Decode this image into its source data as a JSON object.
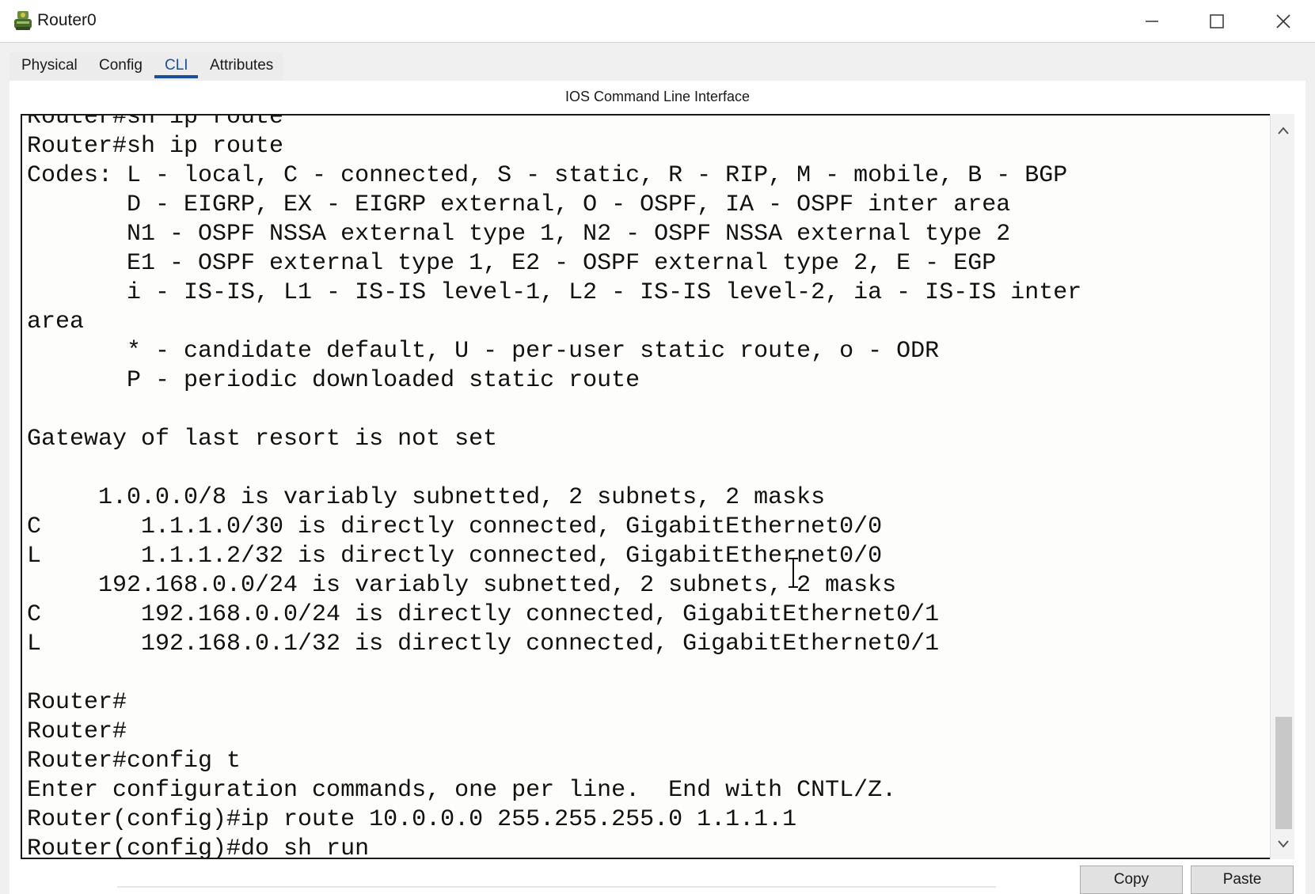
{
  "window": {
    "title": "Router0",
    "icon": "router-app-icon"
  },
  "tabs": [
    {
      "label": "Physical",
      "active": false
    },
    {
      "label": "Config",
      "active": false
    },
    {
      "label": "CLI",
      "active": true
    },
    {
      "label": "Attributes",
      "active": false
    }
  ],
  "cli": {
    "heading": "IOS Command Line Interface",
    "lines": [
      "Router#sh ip route",
      "Router#sh ip route",
      "Codes: L - local, C - connected, S - static, R - RIP, M - mobile, B - BGP",
      "       D - EIGRP, EX - EIGRP external, O - OSPF, IA - OSPF inter area",
      "       N1 - OSPF NSSA external type 1, N2 - OSPF NSSA external type 2",
      "       E1 - OSPF external type 1, E2 - OSPF external type 2, E - EGP",
      "       i - IS-IS, L1 - IS-IS level-1, L2 - IS-IS level-2, ia - IS-IS inter",
      "area",
      "       * - candidate default, U - per-user static route, o - ODR",
      "       P - periodic downloaded static route",
      "",
      "Gateway of last resort is not set",
      "",
      "     1.0.0.0/8 is variably subnetted, 2 subnets, 2 masks",
      "C       1.1.1.0/30 is directly connected, GigabitEthernet0/0",
      "L       1.1.1.2/32 is directly connected, GigabitEthernet0/0",
      "     192.168.0.0/24 is variably subnetted, 2 subnets, 2 masks",
      "C       192.168.0.0/24 is directly connected, GigabitEthernet0/1",
      "L       192.168.0.1/32 is directly connected, GigabitEthernet0/1",
      "",
      "Router#",
      "Router#",
      "Router#config t",
      "Enter configuration commands, one per line.  End with CNTL/Z.",
      "Router(config)#ip route 10.0.0.0 255.255.255.0 1.1.1.1",
      "Router(config)#do sh run"
    ]
  },
  "buttons": {
    "copy": "Copy",
    "paste": "Paste"
  },
  "colors": {
    "accent": "#1a4f9c",
    "terminal_bg": "#fdfdfb",
    "terminal_text": "#111111"
  }
}
